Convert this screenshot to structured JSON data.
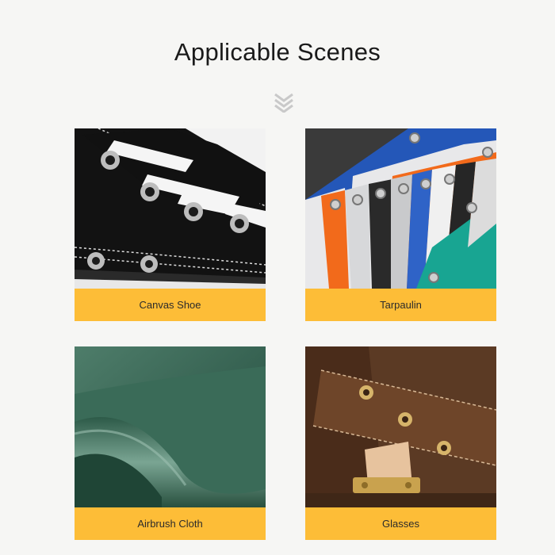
{
  "page": {
    "title": "Applicable Scenes",
    "divider_icon": "double-chevron-down-icon"
  },
  "scenes": [
    {
      "label": "Canvas Shoe",
      "image": "canvas-shoe-photo"
    },
    {
      "label": "Tarpaulin",
      "image": "tarpaulin-photo"
    },
    {
      "label": "Airbrush Cloth",
      "image": "airbrush-cloth-photo"
    },
    {
      "label": "Glasses",
      "image": "leather-bag-photo"
    }
  ],
  "colors": {
    "label_background": "#fdbd37",
    "page_background": "#f6f6f4"
  }
}
